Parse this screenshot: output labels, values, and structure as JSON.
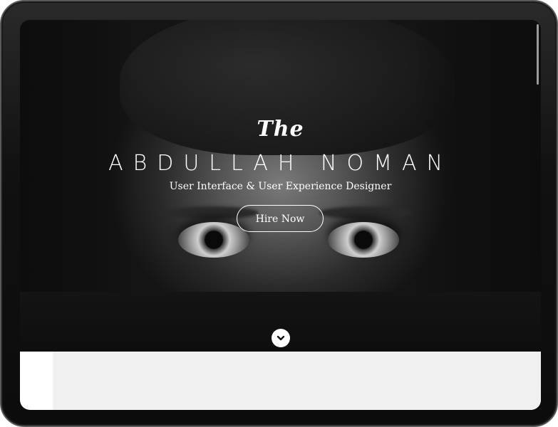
{
  "hero": {
    "prefix": "The",
    "name": "ABDULLAH NOMAN",
    "subtitle": "User Interface & User Experience Designer",
    "cta_label": "Hire Now",
    "scroll_icon": "chevron-down-icon"
  },
  "colors": {
    "device_frame": "#111111",
    "hero_text": "#ffffff",
    "below_panel": "#f0f0f0"
  }
}
